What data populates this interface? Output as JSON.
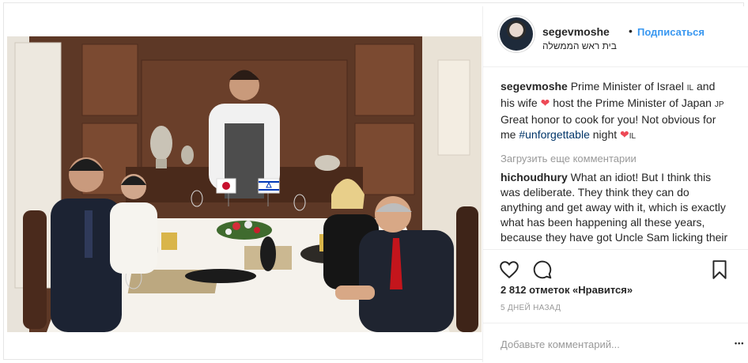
{
  "post": {
    "username": "segevmoshe",
    "dot": "•",
    "follow_label": "Подписаться",
    "location": "בית ראש הממשלה",
    "caption": {
      "username": "segevmoshe",
      "text_1": "Prime Minister of Israel ",
      "flag_il_1": "IL",
      "text_2": " and his wife ",
      "text_3": " host the Prime Minister of Japan ",
      "flag_jp": "JP",
      "text_4": " Great honor to cook for you! Not obvious for me ",
      "hashtag": "#unforgettable",
      "text_5": " night ",
      "flag_il_2": "IL"
    },
    "load_more_label": "Загрузить еще комментарии",
    "comment": {
      "username": "hichoudhury",
      "text": "What an idiot! But I think this was deliberate. They think they can do anything and get away with it, which is exactly what has been happening all these years, because they have got Uncle Sam licking their shoes. This should teach the"
    },
    "likes_text": "2 812 отметок «Нравится»",
    "time_ago": "5 ДНЕЙ НАЗАД",
    "add_comment_placeholder": "Добавьте комментарий...",
    "more_label": "•••",
    "flags_in_photo": {
      "jp_label": "",
      "il_label": ""
    }
  },
  "colors": {
    "link_blue": "#3897f0",
    "hashtag": "#003569",
    "heart_red": "#ed4956",
    "muted": "#999999"
  },
  "icons": {
    "like": "heart-icon",
    "comment": "comment-bubble-icon",
    "save": "bookmark-icon"
  }
}
